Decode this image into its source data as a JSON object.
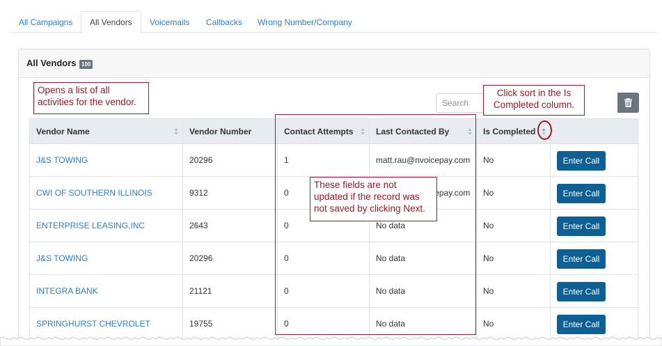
{
  "tabs": [
    {
      "label": "All Campaigns"
    },
    {
      "label": "All Vendors"
    },
    {
      "label": "Voicemails"
    },
    {
      "label": "Callbacks"
    },
    {
      "label": "Wrong Number/Company"
    }
  ],
  "active_tab": "All Vendors",
  "card": {
    "title": "All Vendors",
    "count": "100"
  },
  "search": {
    "placeholder": "Search",
    "value": ""
  },
  "table": {
    "columns": [
      "Vendor Name",
      "Vendor Number",
      "Contact Attempts",
      "Last Contacted By",
      "Is Completed",
      ""
    ],
    "rows": [
      {
        "vendor_name": "J&S TOWING",
        "vendor_number": "20296",
        "contact_attempts": "1",
        "last_contacted_by": "matt.rau@nvoicepay.com",
        "is_completed": "No",
        "action": "Enter Call"
      },
      {
        "vendor_name": "CWI OF SOUTHERN ILLINOIS",
        "vendor_number": "9312",
        "contact_attempts": "0",
        "last_contacted_by": "matt.rau@nvoicepay.com",
        "is_completed": "No",
        "action": "Enter Call"
      },
      {
        "vendor_name": "ENTERPRISE LEASING,INC",
        "vendor_number": "2643",
        "contact_attempts": "0",
        "last_contacted_by": "No data",
        "is_completed": "No",
        "action": "Enter Call"
      },
      {
        "vendor_name": "J&S TOWING",
        "vendor_number": "20296",
        "contact_attempts": "0",
        "last_contacted_by": "No data",
        "is_completed": "No",
        "action": "Enter Call"
      },
      {
        "vendor_name": "INTEGRA BANK",
        "vendor_number": "21121",
        "contact_attempts": "0",
        "last_contacted_by": "No data",
        "is_completed": "No",
        "action": "Enter Call"
      },
      {
        "vendor_name": "SPRINGHURST CHEVROLET",
        "vendor_number": "19755",
        "contact_attempts": "0",
        "last_contacted_by": "No data",
        "is_completed": "No",
        "action": "Enter Call"
      }
    ]
  },
  "annotations": {
    "vendor_link": "Opens a list of all activities for the vendor.",
    "sort": "Click sort in the Is Completed column.",
    "fields": "These fields are not updated if the record was not saved by clicking Next."
  },
  "colors": {
    "link": "#2f80c7",
    "button": "#0d5f94",
    "callout": "#9b1c24",
    "badge": "#6c757d"
  }
}
